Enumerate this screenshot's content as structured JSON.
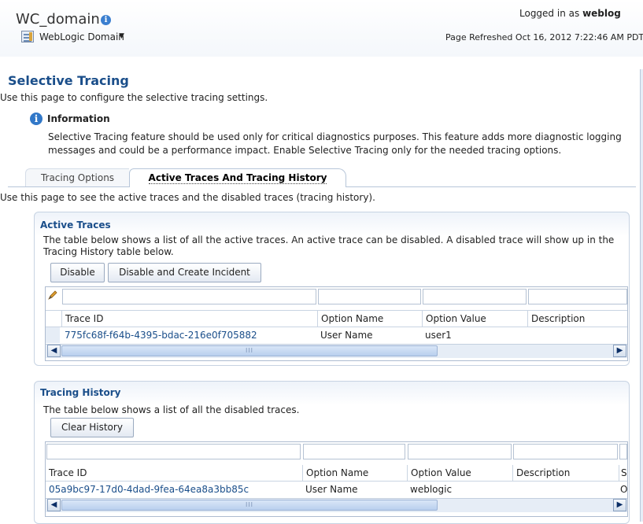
{
  "header": {
    "domain_name": "WC_domain",
    "domain_menu_label": "WebLogic Domain",
    "logged_in_label": "Logged in as",
    "logged_in_user": "weblog",
    "page_refreshed": "Page Refreshed Oct 16, 2012 7:22:46 AM PDT"
  },
  "page": {
    "title": "Selective Tracing",
    "description": "Use this page to configure the selective tracing settings."
  },
  "info": {
    "heading": "Information",
    "text": "Selective Tracing feature should be used only for critical diagnostics purposes. This feature adds more diagnostic logging messages and could be a performance impact. Enable Selective Tracing only for the needed tracing options."
  },
  "tabs": [
    {
      "label": "Tracing Options",
      "selected": false
    },
    {
      "label": "Active Traces And Tracing History",
      "selected": true
    }
  ],
  "tab_description": "Use this page to see the active traces and the disabled traces (tracing history).",
  "active_traces": {
    "title": "Active Traces",
    "description": "The table below shows a list of all the active traces. An active trace can be disabled. A disabled trace will show up in the Tracing History table below.",
    "buttons": {
      "disable": "Disable",
      "disable_incident": "Disable and Create Incident"
    },
    "columns": [
      "Trace ID",
      "Option Name",
      "Option Value",
      "Description"
    ],
    "rows": [
      {
        "trace_id": "775fc68f-f64b-4395-bdac-216e0f705882",
        "option_name": "User Name",
        "option_value": "user1",
        "description": ""
      }
    ]
  },
  "tracing_history": {
    "title": "Tracing History",
    "description": "The table below shows a list of all the disabled traces.",
    "buttons": {
      "clear": "Clear History"
    },
    "columns": [
      "Trace ID",
      "Option Name",
      "Option Value",
      "Description",
      "St"
    ],
    "rows": [
      {
        "trace_id": "05a9bc97-17d0-4dad-9fea-64ea8a3bb85c",
        "option_name": "User Name",
        "option_value": "weblogic",
        "description": "",
        "status": "O"
      }
    ]
  },
  "icons": {
    "info": "info-icon",
    "menu": "domain-menu-icon",
    "filter": "pencil-eraser-icon",
    "scroll_left": "scroll-left-arrow-icon",
    "scroll_right": "scroll-right-arrow-icon"
  },
  "colors": {
    "accent": "#1a4e8a",
    "link": "#1a4e8a",
    "info": "#3278c8"
  }
}
